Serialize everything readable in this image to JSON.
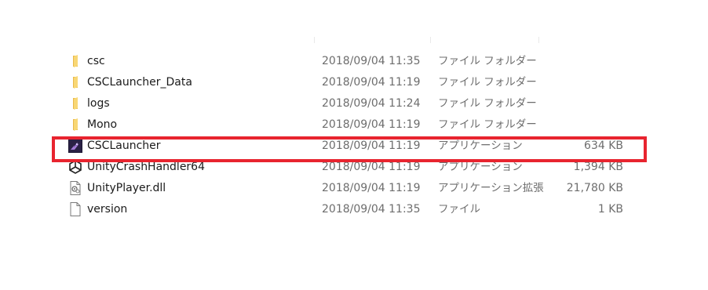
{
  "files": [
    {
      "name": "csc",
      "date": "2018/09/04 11:35",
      "type": "ファイル フォルダー",
      "size": "",
      "icon": "folder-icon"
    },
    {
      "name": "CSCLauncher_Data",
      "date": "2018/09/04 11:19",
      "type": "ファイル フォルダー",
      "size": "",
      "icon": "folder-icon"
    },
    {
      "name": "logs",
      "date": "2018/09/04 11:24",
      "type": "ファイル フォルダー",
      "size": "",
      "icon": "folder-icon"
    },
    {
      "name": "Mono",
      "date": "2018/09/04 11:19",
      "type": "ファイル フォルダー",
      "size": "",
      "icon": "folder-icon"
    },
    {
      "name": "CSCLauncher",
      "date": "2018/09/04 11:19",
      "type": "アプリケーション",
      "size": "634 KB",
      "icon": "app-icon"
    },
    {
      "name": "UnityCrashHandler64",
      "date": "2018/09/04 11:19",
      "type": "アプリケーション",
      "size": "1,394 KB",
      "icon": "unity-icon"
    },
    {
      "name": "UnityPlayer.dll",
      "date": "2018/09/04 11:19",
      "type": "アプリケーション拡張",
      "size": "21,780 KB",
      "icon": "dll-icon"
    },
    {
      "name": "version",
      "date": "2018/09/04 11:35",
      "type": "ファイル",
      "size": "1 KB",
      "icon": "file-icon"
    }
  ],
  "colors": {
    "highlight": "#e8242f",
    "folder": "#f8d775",
    "text_primary": "#1a1a1a",
    "text_secondary": "#6d6d6d"
  }
}
